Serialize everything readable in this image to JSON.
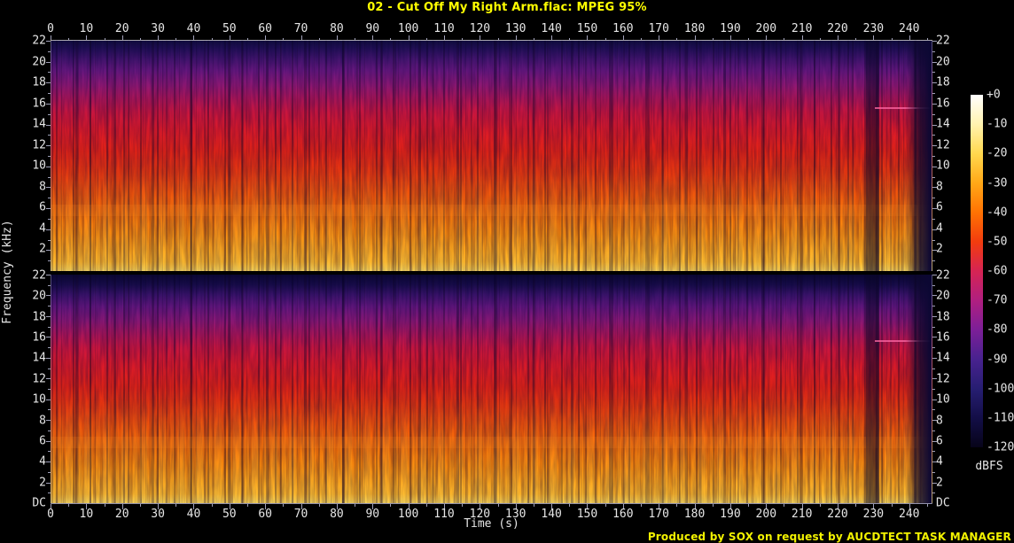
{
  "title": "02 - Cut Off My Right Arm.flac: MPEG 95%",
  "footer": "Produced by SOX on request by AUCDTECT TASK MANAGER",
  "chart_data": {
    "type": "heatmap",
    "subtype": "audio-spectrogram",
    "title": "02 - Cut Off My Right Arm.flac: MPEG 95%",
    "xlabel": "Time (s)",
    "ylabel": "Frequency (kHz)",
    "xlim": [
      0,
      246.5
    ],
    "x_major_ticks": [
      0,
      10,
      20,
      30,
      40,
      50,
      60,
      70,
      80,
      90,
      100,
      110,
      120,
      130,
      140,
      150,
      160,
      170,
      180,
      190,
      200,
      210,
      220,
      230,
      240
    ],
    "x_minor_step": 5,
    "ylim_khz": [
      0,
      22
    ],
    "y_major_ticks_khz": [
      22,
      20,
      18,
      16,
      14,
      12,
      10,
      8,
      6,
      4,
      2
    ],
    "y_minor_step_khz": 1,
    "y_dc_label": "DC",
    "channels": [
      "channel-1-top",
      "channel-2-bottom"
    ],
    "duration_s": 247,
    "colorbar": {
      "label": "dBFS",
      "tick_labels": [
        "+0",
        "-10",
        "-20",
        "-30",
        "-40",
        "-50",
        "-60",
        "-70",
        "-80",
        "-90",
        "-100",
        "-110",
        "-120"
      ],
      "range_db": [
        0,
        -120
      ],
      "palette_top_to_bottom": [
        "#ffffff",
        "#fff3b0",
        "#ffd84e",
        "#ffa817",
        "#ff7303",
        "#f23c0e",
        "#d62453",
        "#b01f80",
        "#7c1f98",
        "#48228f",
        "#271e72",
        "#130e47",
        "#070419"
      ]
    },
    "energy_profile_db_by_band_khz": {
      "0-2": -15,
      "2-6": -35,
      "6-10": -45,
      "10-16": -55,
      "16-19": -70,
      "19-21": -90,
      "21-22": -108
    },
    "events": [
      {
        "time_s": 229,
        "description": "quiet gap - dark vertical band in both channels"
      },
      {
        "time_s": 233,
        "description": "sparser outro with faint tonal line near 15.8 kHz"
      },
      {
        "time_s": 241,
        "description": "fade-out to silence at end of track"
      }
    ],
    "notes": "Two-channel (stereo) SoX spectrogram; dense vertical beat striations throughout; strong low-frequency energy band (bright yellow-orange) below ~2 kHz in both channels."
  }
}
